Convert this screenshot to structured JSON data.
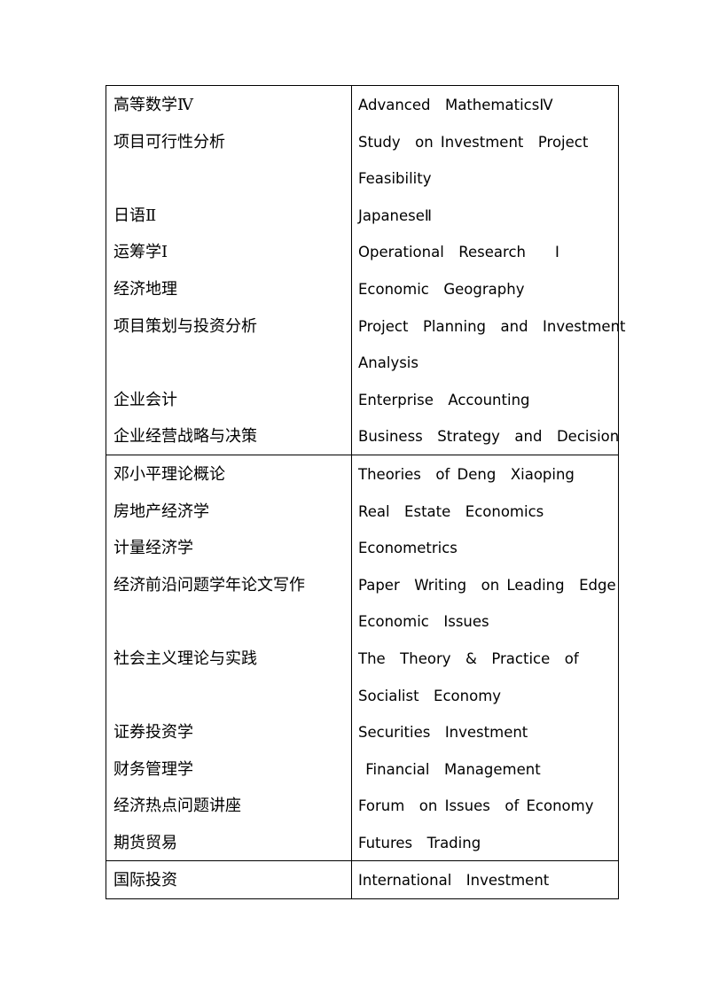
{
  "table": {
    "sections": [
      {
        "rows": [
          {
            "cn": [
              "高等数学Ⅳ"
            ],
            "en": [
              "Advanced  MathematicsⅣ"
            ]
          },
          {
            "cn": [
              "项目可行性分析",
              ""
            ],
            "en": [
              "Study  on Investment  Project",
              "Feasibility"
            ]
          },
          {
            "cn": [
              "日语Ⅱ"
            ],
            "en": [
              "JapaneseⅡ"
            ]
          },
          {
            "cn": [
              "运筹学Ⅰ"
            ],
            "en": [
              "Operational  Research    Ⅰ"
            ]
          },
          {
            "cn": [
              "经济地理"
            ],
            "en": [
              "Economic  Geography"
            ]
          },
          {
            "cn": [
              "项目策划与投资分析",
              ""
            ],
            "en": [
              "Project  Planning  and  Investment",
              "Analysis"
            ]
          },
          {
            "cn": [
              "企业会计"
            ],
            "en": [
              "Enterprise  Accounting"
            ]
          },
          {
            "cn": [
              "企业经营战略与决策"
            ],
            "en": [
              "Business  Strategy  and  Decision"
            ]
          }
        ]
      },
      {
        "rows": [
          {
            "cn": [
              "邓小平理论概论"
            ],
            "en": [
              "Theories  of Deng  Xiaoping"
            ]
          },
          {
            "cn": [
              "房地产经济学"
            ],
            "en": [
              "Real  Estate  Economics"
            ]
          },
          {
            "cn": [
              "计量经济学"
            ],
            "en": [
              "Econometrics"
            ]
          },
          {
            "cn": [
              "经济前沿问题学年论文写作",
              ""
            ],
            "en": [
              "Paper  Writing  on Leading  Edge",
              "Economic  Issues"
            ]
          },
          {
            "cn": [
              "社会主义理论与实践",
              ""
            ],
            "en": [
              "The  Theory  &  Practice  of",
              "Socialist  Economy"
            ]
          },
          {
            "cn": [
              "证券投资学"
            ],
            "en": [
              "Securities  Investment"
            ]
          },
          {
            "cn": [
              "财务管理学"
            ],
            "en": [
              " Financial  Management"
            ]
          },
          {
            "cn": [
              "经济热点问题讲座"
            ],
            "en": [
              "Forum  on Issues  of Economy"
            ]
          },
          {
            "cn": [
              "期货贸易"
            ],
            "en": [
              "Futures  Trading"
            ]
          }
        ]
      },
      {
        "rows": [
          {
            "cn": [
              "国际投资"
            ],
            "en": [
              "International  Investment"
            ]
          }
        ]
      }
    ]
  }
}
